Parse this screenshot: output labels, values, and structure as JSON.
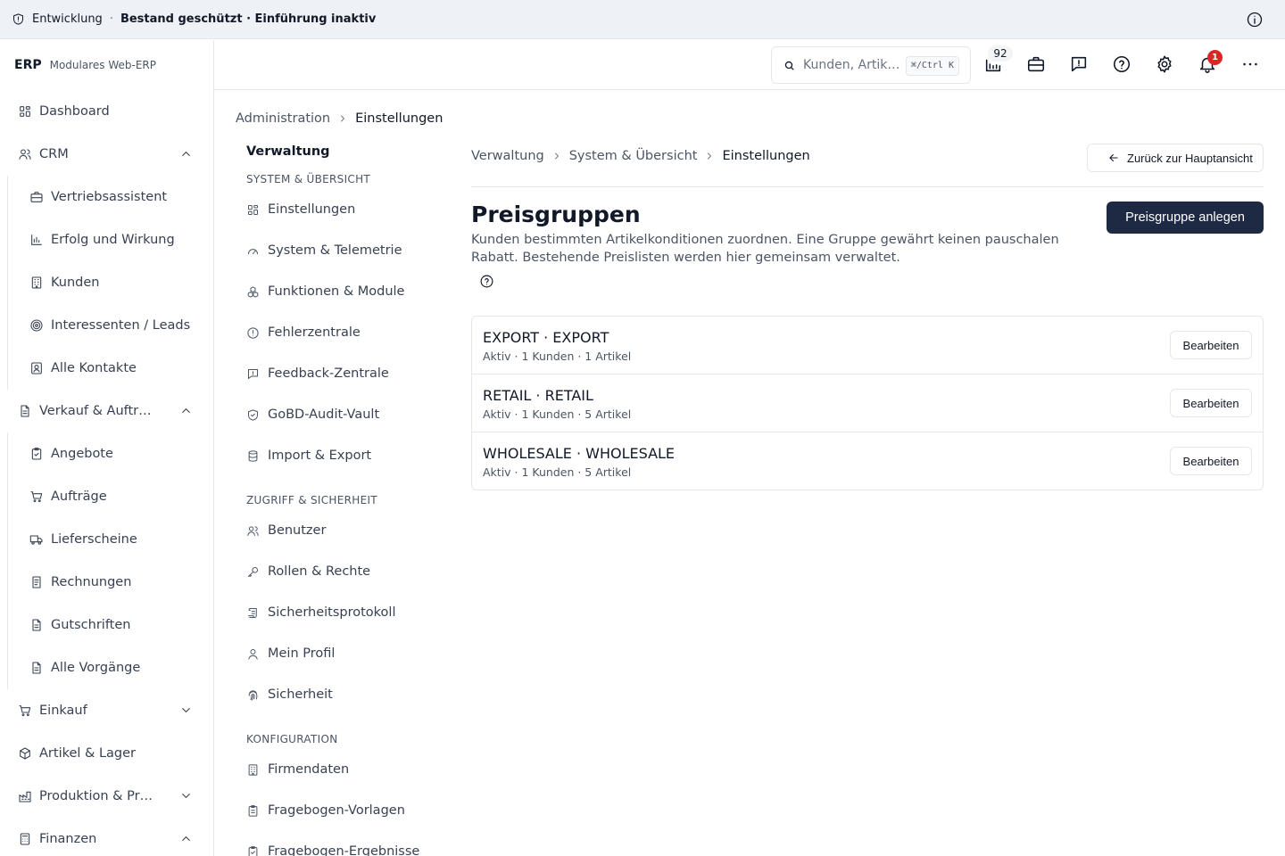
{
  "banner": {
    "env": "Entwicklung",
    "separator": "·",
    "status": "Bestand geschützt · Einführung inaktiv"
  },
  "sidebar": {
    "brand": "ERP",
    "subtitle": "Modulares Web-ERP",
    "dashboard": "Dashboard",
    "crm": {
      "label": "CRM",
      "children": [
        "Vertriebsassistent",
        "Erfolg und Wirkung",
        "Kunden",
        "Interessenten / Leads",
        "Alle Kontakte"
      ]
    },
    "sales": {
      "label": "Verkauf & Auftr…",
      "children": [
        "Angebote",
        "Aufträge",
        "Lieferscheine",
        "Rechnungen",
        "Gutschriften",
        "Alle Vorgänge"
      ]
    },
    "purchasing": "Einkauf",
    "inventory": "Artikel & Lager",
    "production": "Produktion & Pr…",
    "finance": "Finanzen"
  },
  "topbar": {
    "search_placeholder": "Kunden, Artik…",
    "shortcut": "⌘/Ctrl K",
    "queue_count": "92",
    "notification_count": "1"
  },
  "page_breadcrumb": [
    "Administration",
    "Einstellungen"
  ],
  "subnav": {
    "title": "Verwaltung",
    "sections": [
      {
        "title": "SYSTEM & ÜBERSICHT",
        "items": [
          "Einstellungen",
          "System & Telemetrie",
          "Funktionen & Module",
          "Fehlerzentrale",
          "Feedback-Zentrale",
          "GoBD-Audit-Vault",
          "Import & Export"
        ]
      },
      {
        "title": "ZUGRIFF & SICHERHEIT",
        "items": [
          "Benutzer",
          "Rollen & Rechte",
          "Sicherheitsprotokoll",
          "Mein Profil",
          "Sicherheit"
        ]
      },
      {
        "title": "KONFIGURATION",
        "items": [
          "Firmendaten",
          "Fragebogen-Vorlagen",
          "Fragebogen-Ergebnisse"
        ]
      }
    ]
  },
  "main": {
    "breadcrumb": [
      "Verwaltung",
      "System & Übersicht",
      "Einstellungen"
    ],
    "back_label": "Zurück zur Hauptansicht",
    "title": "Preisgruppen",
    "description": "Kunden bestimmten Artikelkonditionen zuordnen. Eine Gruppe gewährt keinen pauschalen Rabatt. Bestehende Preislisten werden hier gemeinsam verwaltet.",
    "create_label": "Preisgruppe anlegen",
    "edit_label": "Bearbeiten",
    "groups": [
      {
        "name": "EXPORT · EXPORT",
        "meta": "Aktiv · 1 Kunden · 1 Artikel"
      },
      {
        "name": "RETAIL · RETAIL",
        "meta": "Aktiv · 1 Kunden · 5 Artikel"
      },
      {
        "name": "WHOLESALE · WHOLESALE",
        "meta": "Aktiv · 1 Kunden · 5 Artikel"
      }
    ]
  }
}
